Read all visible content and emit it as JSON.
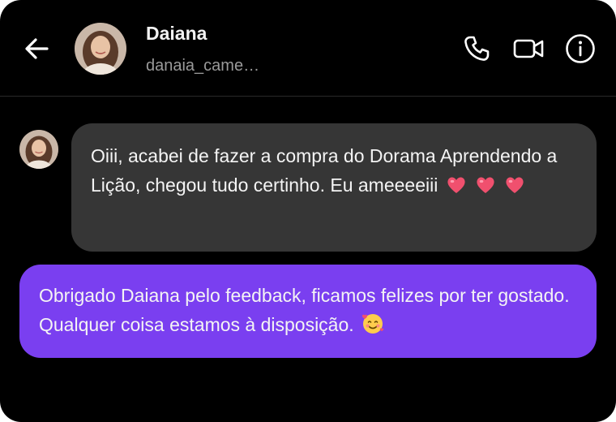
{
  "header": {
    "contact_name": "Daiana",
    "contact_handle": "danaia_came…",
    "back_icon": "arrow-left-icon",
    "actions": [
      "phone-icon",
      "video-camera-icon",
      "info-icon"
    ]
  },
  "messages": [
    {
      "direction": "incoming",
      "text": "Oiii, acabei de fazer a compra do Dorama Aprendendo a Lição, chegou tudo certinho. Eu ameeeeiii",
      "emojis": [
        "heart-emoji",
        "heart-emoji",
        "heart-emoji"
      ],
      "bubble_color": "#363636"
    },
    {
      "direction": "outgoing",
      "text": "Obrigado Daiana pelo feedback, ficamos felizes por ter gostado. Qualquer coisa estamos à disposição.",
      "emojis": [
        "smiling-face-with-hearts-emoji"
      ],
      "bubble_color": "#7a3ff0"
    }
  ],
  "colors": {
    "background": "#000000",
    "handle_text": "#9a9a9a",
    "accent": "#7a3ff0",
    "heart": "#f0506e"
  }
}
